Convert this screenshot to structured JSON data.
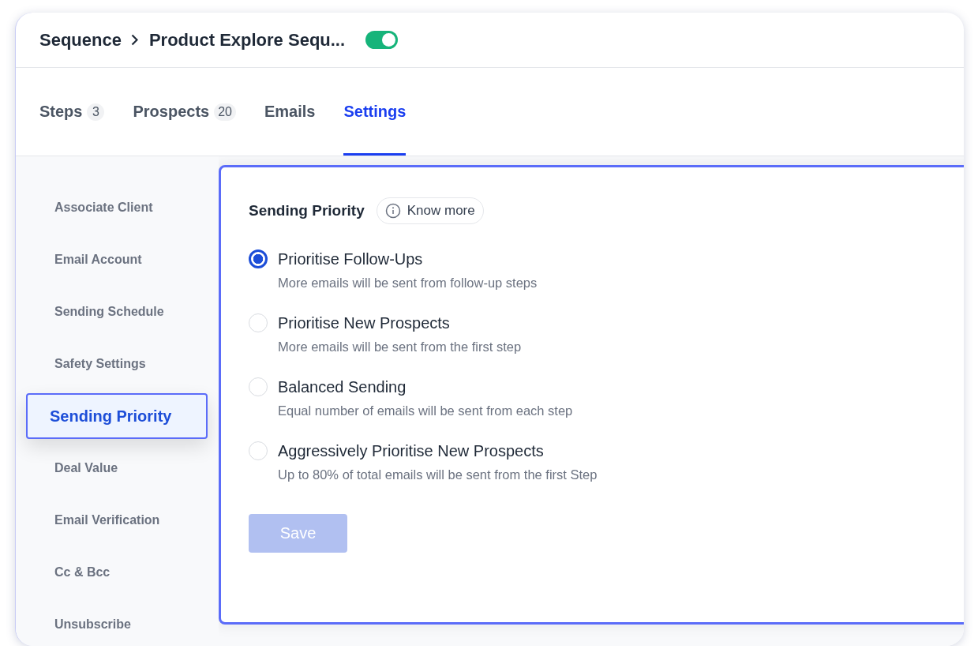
{
  "header": {
    "breadcrumb": "Sequence",
    "title": "Product Explore Sequ...",
    "toggle_on": true
  },
  "tabs": [
    {
      "label": "Steps",
      "count": "3",
      "selected": false
    },
    {
      "label": "Prospects",
      "count": "20",
      "selected": false
    },
    {
      "label": "Emails",
      "selected": false
    },
    {
      "label": "Settings",
      "selected": true
    }
  ],
  "sidebar": {
    "items": [
      {
        "label": "Associate Client",
        "selected": false
      },
      {
        "label": "Email Account",
        "selected": false
      },
      {
        "label": "Sending Schedule",
        "selected": false
      },
      {
        "label": "Safety Settings",
        "selected": false
      },
      {
        "label": "Sending Priority",
        "selected": true
      },
      {
        "label": "Deal Value",
        "selected": false
      },
      {
        "label": "Email Verification",
        "selected": false
      },
      {
        "label": "Cc & Bcc",
        "selected": false
      },
      {
        "label": "Unsubscribe",
        "selected": false
      }
    ]
  },
  "panel": {
    "title": "Sending Priority",
    "know_more": "Know more",
    "options": [
      {
        "label": "Prioritise Follow-Ups",
        "description": "More emails will be sent from follow-up steps",
        "selected": true
      },
      {
        "label": "Prioritise New Prospects",
        "description": "More emails will be sent from the first step",
        "selected": false
      },
      {
        "label": "Balanced Sending",
        "description": "Equal number of emails will be sent from each step",
        "selected": false
      },
      {
        "label": "Aggressively Prioritise New Prospects",
        "description": "Up to 80% of total emails will be sent from the first Step",
        "selected": false
      }
    ],
    "save": {
      "label": "Save",
      "disabled": true
    }
  }
}
